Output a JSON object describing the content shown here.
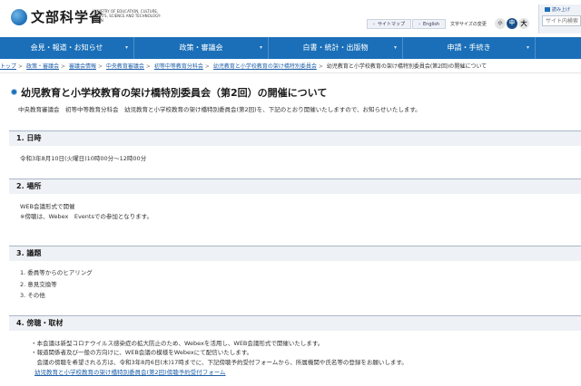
{
  "header": {
    "logo_text": "文部科学省",
    "logo_sub": "MINISTRY OF EDUCATION, CULTURE, SPORTS, SCIENCE AND TECHNOLOGY-JAPAN",
    "sitemap": "サイトマップ",
    "english": "English",
    "font_size_label": "文字サイズの変更",
    "font_small": "小",
    "font_mid": "中",
    "font_large": "大",
    "panel_link": "読み上げ",
    "search_placeholder": "サイト内検索"
  },
  "nav": {
    "items": [
      "会見・報道・お知らせ",
      "政策・審議会",
      "白書・統計・出版物",
      "申請・手続き",
      ""
    ]
  },
  "breadcrumb": {
    "items": [
      "トップ",
      "政策・審議会",
      "審議会情報",
      "中央教育審議会",
      "初等中等教育分科会",
      "幼児教育と小学校教育の架け橋特別委員会"
    ],
    "current": "幼児教育と小学校教育の架け橋特別委員会(第2回)の開催について"
  },
  "page": {
    "title": "幼児教育と小学校教育の架け橋特別委員会（第2回）の開催について",
    "intro": "中央教育審議会　初等中等教育分科会　幼児教育と小学校教育の架け橋特別委員会(第2回)を、下記のとおり開催いたしますので、お知らせいたします。"
  },
  "sections": {
    "s1": {
      "heading": "1. 日時",
      "lines": [
        "令和3年8月10日(火曜日)10時00分～12時00分"
      ]
    },
    "s2": {
      "heading": "2. 場所",
      "lines": [
        "WEB会議形式で開催",
        "※傍聴は、Webex　Eventsでの参加となります。"
      ]
    },
    "s3": {
      "heading": "3. 議題",
      "lines": [
        "1. 委員等からのヒアリング",
        "2. 意見交換等",
        "3. その他"
      ]
    },
    "s4": {
      "heading": "4. 傍聴・取材",
      "lines": [
        "・本会議は新型コロナウイルス感染症の拡大防止のため、Webexを活用し、WEB会議形式で開催いたします。",
        "・報道関係者及び一般の方向けに、WEB会議の模様をWebexにて配信いたします。",
        "　会議の傍聴を希望される方は、令和3年8月6日(木)17時までに、下記傍聴予約受付フォームから、所属機関や氏名等の登録をお願いします。"
      ],
      "link": "幼児教育と小学校教育の架け橋特別委員会(第2回)傍聴予約受付フォーム"
    }
  }
}
